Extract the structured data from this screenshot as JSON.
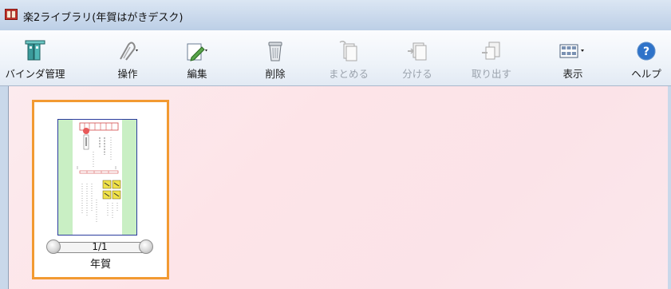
{
  "window": {
    "title": "楽2ライブラリ(年賀はがきデスク)"
  },
  "toolbar": {
    "items": [
      {
        "label": "バインダ管理",
        "icon": "binder-icon",
        "enabled": true
      },
      {
        "label": "操作",
        "icon": "operation-icon",
        "enabled": true
      },
      {
        "label": "編集",
        "icon": "edit-icon",
        "enabled": true
      },
      {
        "label": "削除",
        "icon": "trash-icon",
        "enabled": true
      },
      {
        "label": "まとめる",
        "icon": "combine-icon",
        "enabled": false
      },
      {
        "label": "分ける",
        "icon": "split-icon",
        "enabled": false
      },
      {
        "label": "取り出す",
        "icon": "extract-icon",
        "enabled": false
      },
      {
        "label": "表示",
        "icon": "view-icon",
        "enabled": true
      },
      {
        "label": "ヘルプ",
        "icon": "help-icon",
        "enabled": true
      }
    ]
  },
  "document": {
    "page_indicator": "1/1",
    "label": "年賀"
  },
  "colors": {
    "selection_border": "#f29a32",
    "postcard_border": "#2b3c9e",
    "content_background": "#fde4e8"
  }
}
